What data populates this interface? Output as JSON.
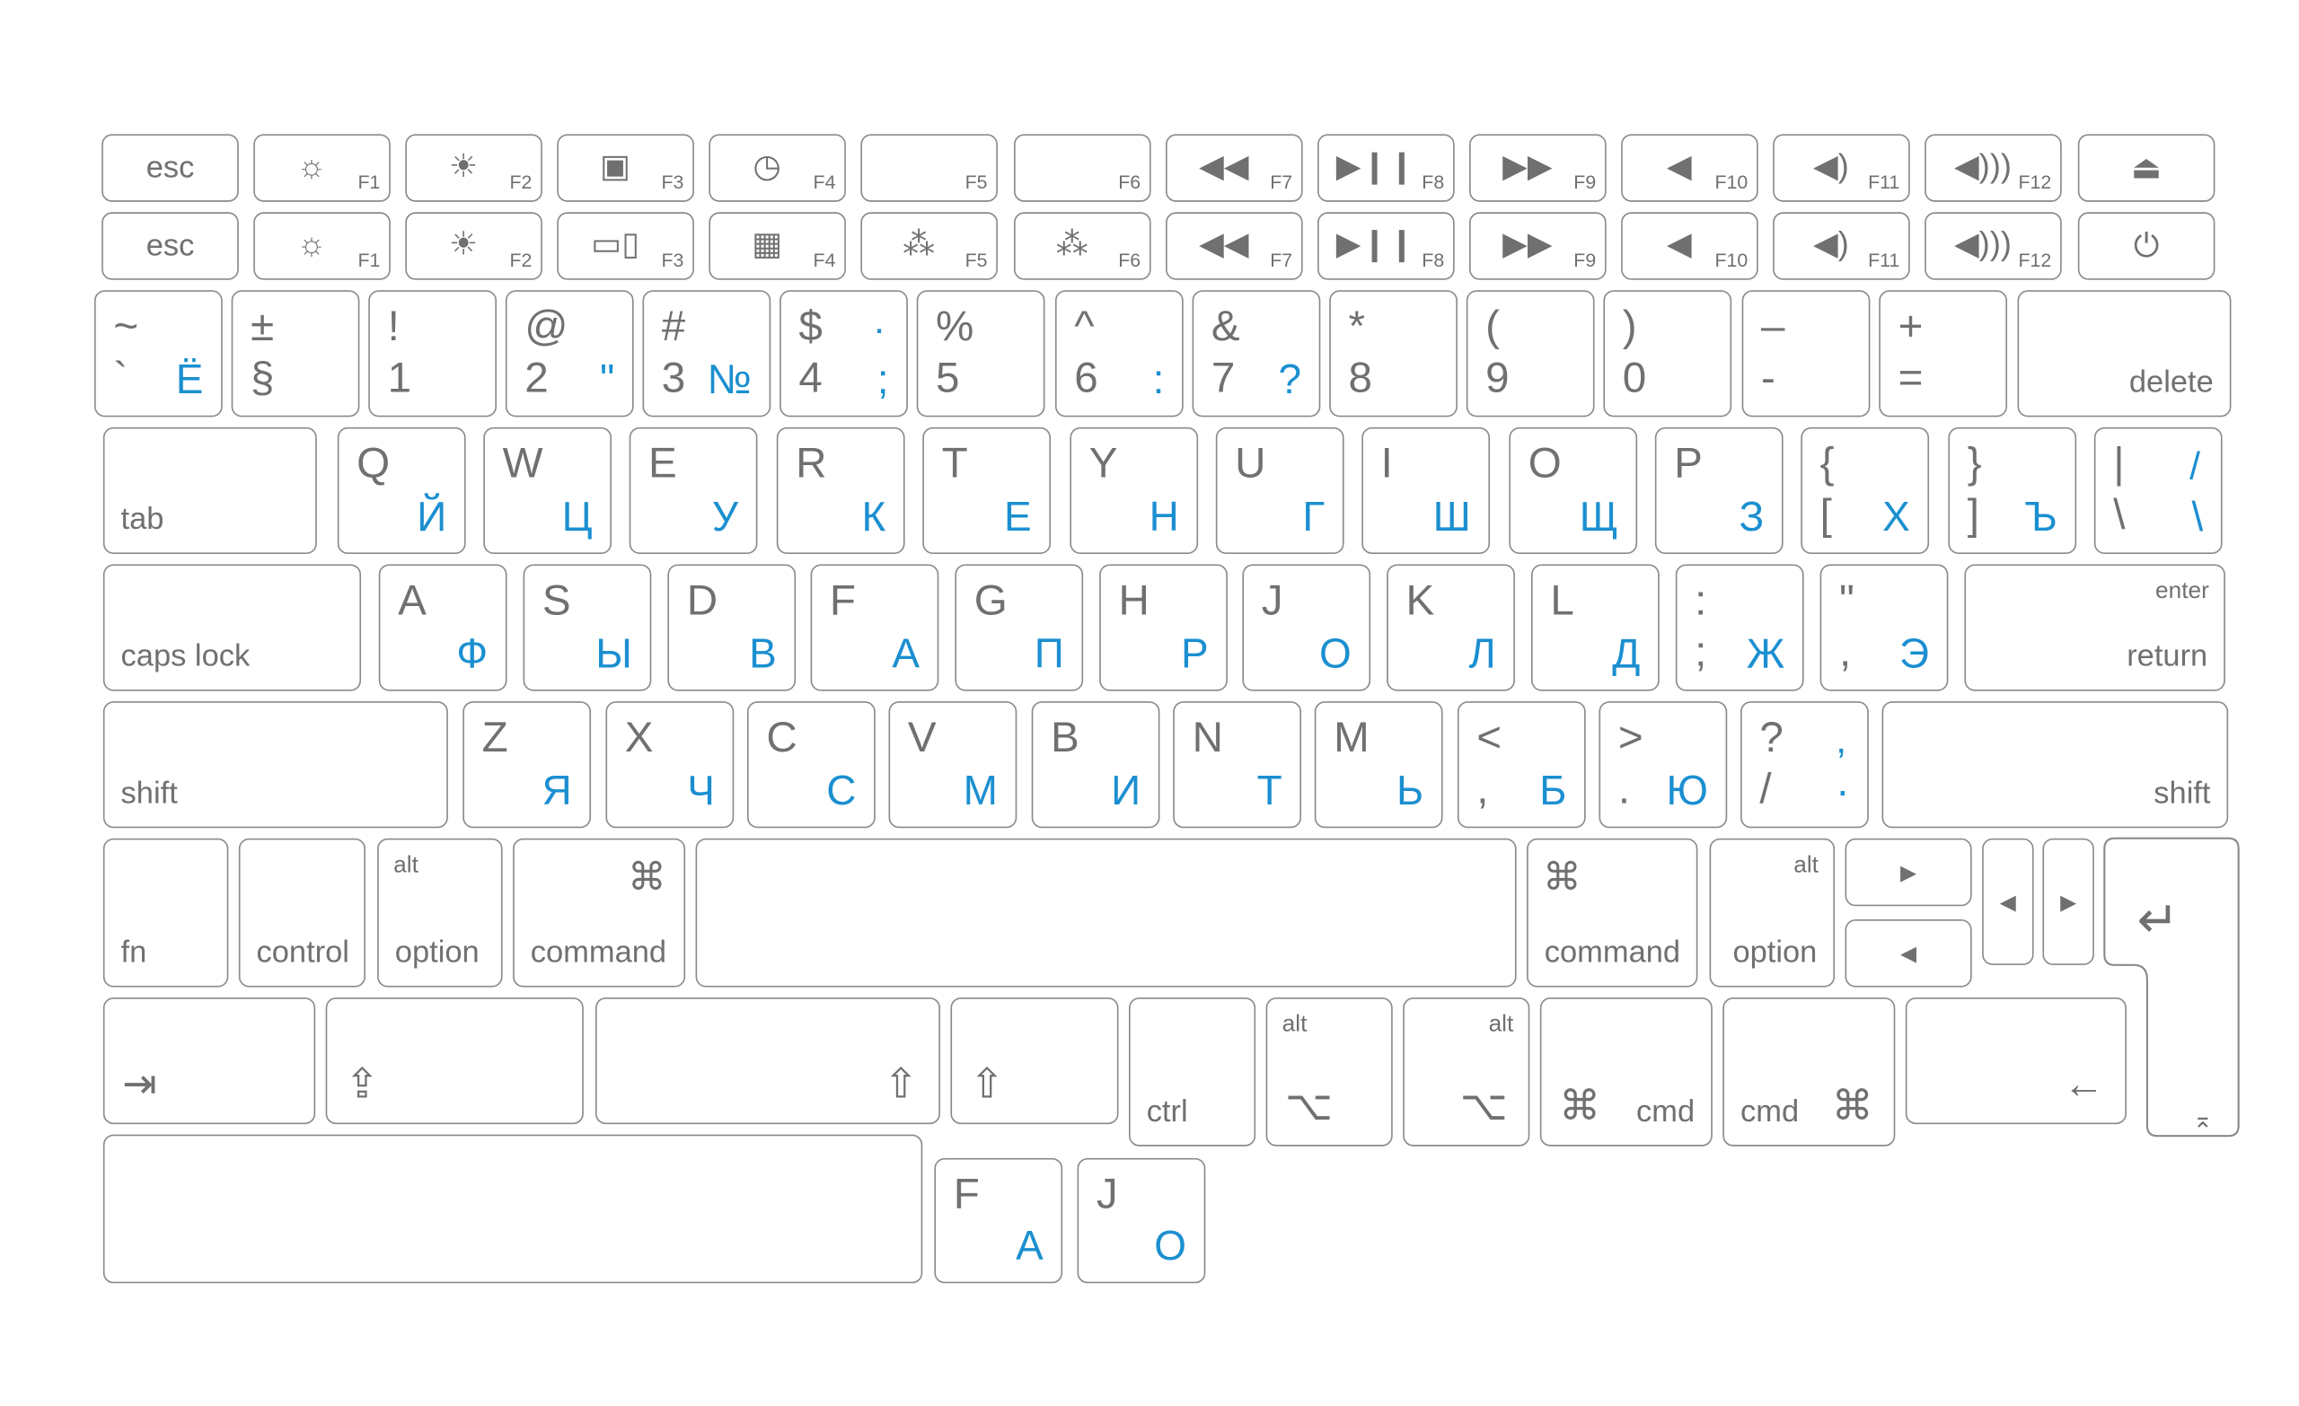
{
  "colors": {
    "legend_grey": "#707070",
    "cyrillic_blue": "#1b8fd0",
    "key_border": "#8a8a8a"
  },
  "rows": [
    {
      "keys": [
        {
          "lbl": "esc",
          "lpos": "c"
        },
        {
          "icon": "brightness-down",
          "glyph": "☼",
          "ipos": "cl",
          "fn": "F1"
        },
        {
          "icon": "brightness-up",
          "glyph": "☀",
          "ipos": "cl",
          "fn": "F2"
        },
        {
          "icon": "mission-control",
          "glyph": "▣",
          "ipos": "cl",
          "fn": "F3"
        },
        {
          "icon": "dashboard",
          "glyph": "◷",
          "ipos": "cl",
          "fn": "F4"
        },
        {
          "fn": "F5"
        },
        {
          "fn": "F6"
        },
        {
          "icon": "rewind",
          "glyph": "◀◀",
          "ipos": "cl",
          "fn": "F7"
        },
        {
          "icon": "play-pause",
          "glyph": "▶❙❙",
          "ipos": "cl",
          "fn": "F8"
        },
        {
          "icon": "fast-forward",
          "glyph": "▶▶",
          "ipos": "cl",
          "fn": "F9"
        },
        {
          "icon": "mute",
          "glyph": "◀",
          "ipos": "cl",
          "fn": "F10"
        },
        {
          "icon": "volume-down",
          "glyph": "◀)",
          "ipos": "cl",
          "fn": "F11"
        },
        {
          "icon": "volume-up",
          "glyph": "◀)))",
          "ipos": "cl",
          "fn": "F12"
        },
        {
          "icon": "eject",
          "glyph": "⏏",
          "ipos": "c"
        }
      ]
    },
    {
      "keys": [
        {
          "lbl": "esc",
          "lpos": "c"
        },
        {
          "icon": "brightness-down",
          "glyph": "☼",
          "ipos": "cl",
          "fn": "F1"
        },
        {
          "icon": "brightness-up",
          "glyph": "☀",
          "ipos": "cl",
          "fn": "F2"
        },
        {
          "icon": "mission-control",
          "glyph": "▭▯",
          "ipos": "cl",
          "fn": "F3"
        },
        {
          "icon": "launchpad",
          "glyph": "▦",
          "ipos": "cl",
          "fn": "F4"
        },
        {
          "icon": "keyboard-backlight-down",
          "glyph": "⁂",
          "ipos": "cl",
          "fn": "F5"
        },
        {
          "icon": "keyboard-backlight-up",
          "glyph": "⁂",
          "ipos": "cl",
          "fn": "F6"
        },
        {
          "icon": "rewind",
          "glyph": "◀◀",
          "ipos": "cl",
          "fn": "F7"
        },
        {
          "icon": "play-pause",
          "glyph": "▶❙❙",
          "ipos": "cl",
          "fn": "F8"
        },
        {
          "icon": "fast-forward",
          "glyph": "▶▶",
          "ipos": "cl",
          "fn": "F9"
        },
        {
          "icon": "mute",
          "glyph": "◀",
          "ipos": "cl",
          "fn": "F10"
        },
        {
          "icon": "volume-down",
          "glyph": "◀)",
          "ipos": "cl",
          "fn": "F11"
        },
        {
          "icon": "volume-up",
          "glyph": "◀)))",
          "ipos": "cl",
          "fn": "F12"
        },
        {
          "icon": "power",
          "glyph": "⏻",
          "ipos": "c"
        }
      ]
    },
    {
      "keys": [
        {
          "t": "~",
          "b": "`",
          "rb": "Ё"
        },
        {
          "t": "±",
          "b": "§"
        },
        {
          "t": "!",
          "b": "1"
        },
        {
          "t": "@",
          "b": "2",
          "rb": "\""
        },
        {
          "t": "#",
          "b": "3",
          "rb": "№"
        },
        {
          "t": "$",
          "b": "4",
          "rt": "·",
          "rb": ";"
        },
        {
          "t": "%",
          "b": "5"
        },
        {
          "t": "^",
          "b": "6",
          "rb": ":"
        },
        {
          "t": "&",
          "b": "7",
          "rb": "?"
        },
        {
          "t": "*",
          "b": "8"
        },
        {
          "t": "(",
          "b": "9"
        },
        {
          "t": ")",
          "b": "0"
        },
        {
          "t": "–",
          "b": "-"
        },
        {
          "t": "+",
          "b": "="
        },
        {
          "lbl": "delete",
          "lpos": "br"
        }
      ]
    },
    {
      "keys": [
        {
          "lbl": "tab",
          "lpos": "bl"
        },
        {
          "t": "Q",
          "rb": "Й"
        },
        {
          "t": "W",
          "rb": "Ц"
        },
        {
          "t": "E",
          "rb": "У"
        },
        {
          "t": "R",
          "rb": "К"
        },
        {
          "t": "T",
          "rb": "Е"
        },
        {
          "t": "Y",
          "rb": "Н"
        },
        {
          "t": "U",
          "rb": "Г"
        },
        {
          "t": "I",
          "rb": "Ш"
        },
        {
          "t": "O",
          "rb": "Щ"
        },
        {
          "t": "P",
          "rb": "З"
        },
        {
          "t": "{",
          "b": "[",
          "rb": "Х"
        },
        {
          "t": "}",
          "b": "]",
          "rb": "Ъ"
        },
        {
          "t": "|",
          "b": "\\",
          "rt": "/",
          "rb": "\\"
        }
      ]
    },
    {
      "keys": [
        {
          "lbl": "caps lock",
          "lpos": "bl"
        },
        {
          "t": "A",
          "rb": "Ф"
        },
        {
          "t": "S",
          "rb": "Ы"
        },
        {
          "t": "D",
          "rb": "В"
        },
        {
          "t": "F",
          "rb": "А"
        },
        {
          "t": "G",
          "rb": "П"
        },
        {
          "t": "H",
          "rb": "Р"
        },
        {
          "t": "J",
          "rb": "О"
        },
        {
          "t": "K",
          "rb": "Л"
        },
        {
          "t": "L",
          "rb": "Д"
        },
        {
          "t": ":",
          "b": ";",
          "rb": "Ж"
        },
        {
          "t": "\"",
          "b": ",",
          "rb": "Э"
        },
        {
          "lbl": "return",
          "lpos": "br",
          "sm": "enter",
          "spos": "tr"
        }
      ]
    },
    {
      "keys": [
        {
          "lbl": "shift",
          "lpos": "bl"
        },
        {
          "t": "Z",
          "rb": "Я"
        },
        {
          "t": "X",
          "rb": "Ч"
        },
        {
          "t": "C",
          "rb": "С"
        },
        {
          "t": "V",
          "rb": "М"
        },
        {
          "t": "B",
          "rb": "И"
        },
        {
          "t": "N",
          "rb": "Т"
        },
        {
          "t": "M",
          "rb": "Ь"
        },
        {
          "t": "<",
          "b": ",",
          "rb": "Б"
        },
        {
          "t": ">",
          "b": ".",
          "rb": "Ю"
        },
        {
          "t": "?",
          "b": "/",
          "rt": ",",
          "rb": "·"
        },
        {
          "lbl": "shift",
          "lpos": "br"
        }
      ]
    },
    {
      "keys": [
        {
          "lbl": "fn",
          "lpos": "bl"
        },
        {
          "lbl": "control",
          "lpos": "bl"
        },
        {
          "lbl": "option",
          "lpos": "bl",
          "sm": "alt",
          "spos": "tl"
        },
        {
          "lbl": "command",
          "lpos": "bl",
          "icon": "command",
          "glyph": "⌘",
          "ipos": "tr"
        },
        {},
        {
          "lbl": "command",
          "lpos": "bl",
          "icon": "command",
          "glyph": "⌘",
          "ipos": "tl"
        },
        {
          "lbl": "option",
          "lpos": "br",
          "sm": "alt",
          "spos": "tr"
        },
        {
          "icon": "arrow-right",
          "glyph": "▸",
          "ipos": "c"
        },
        {
          "icon": "arrow-left",
          "glyph": "◂",
          "ipos": "c"
        },
        {
          "icon": "arrow-left",
          "glyph": "◂",
          "ipos": "c"
        },
        {
          "icon": "arrow-right",
          "glyph": "▸",
          "ipos": "c"
        }
      ]
    },
    {
      "keys": [
        {
          "icon": "tab-arrow",
          "glyph": "⇥",
          "ipos": "bl"
        },
        {
          "icon": "caps-lock-arrow",
          "glyph": "⇪",
          "ipos": "bl"
        },
        {
          "icon": "shift-arrow",
          "glyph": "⇧",
          "ipos": "br"
        },
        {
          "icon": "shift-arrow",
          "glyph": "⇧",
          "ipos": "bl"
        },
        {
          "lbl": "ctrl",
          "lpos": "bl"
        },
        {
          "sm": "alt",
          "spos": "tl",
          "icon": "option",
          "glyph": "⌥",
          "ipos": "bl"
        },
        {
          "sm": "alt",
          "spos": "tr",
          "icon": "option",
          "glyph": "⌥",
          "ipos": "br"
        },
        {
          "lbl": "cmd",
          "lpos": "br",
          "icon": "command",
          "glyph": "⌘",
          "ipos": "bl"
        },
        {
          "lbl": "cmd",
          "lpos": "bl",
          "icon": "command",
          "glyph": "⌘",
          "ipos": "br"
        },
        {
          "icon": "backspace-arrow",
          "glyph": "←",
          "ipos": "br"
        }
      ]
    },
    {
      "keys": [
        {},
        {
          "t": "F",
          "rb": "А"
        },
        {
          "t": "J",
          "rb": "О"
        }
      ]
    }
  ],
  "return_key": {
    "icon": "return",
    "glyph": "↵",
    "icon2": "enter-small",
    "glyph2": "⌅"
  }
}
